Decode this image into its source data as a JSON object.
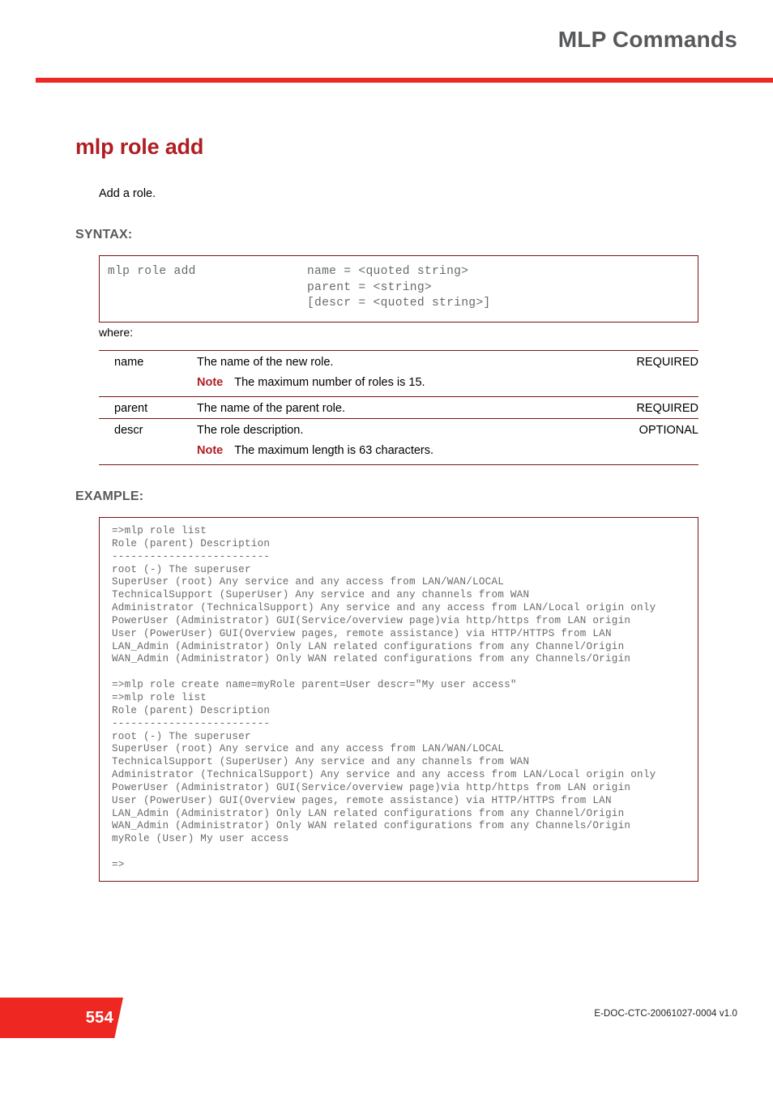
{
  "header": {
    "title": "MLP Commands",
    "rule_color": "#ee2722"
  },
  "page": {
    "section_title": "mlp role add",
    "intro": "Add a role.",
    "accent_color": "#b01e23",
    "box_border_color": "#7c1416"
  },
  "syntax": {
    "label": "SYNTAX:",
    "rows": [
      {
        "command": "mlp role add",
        "argument": "name = <quoted string>"
      },
      {
        "command": "",
        "argument": "parent = <string>"
      },
      {
        "command": "",
        "argument": "[descr = <quoted string>]"
      }
    ]
  },
  "where": {
    "label": "where:",
    "rows": [
      {
        "term": "name",
        "description": "The name of the new role.",
        "requirement": "REQUIRED",
        "note_keyword": "Note",
        "note": "The maximum number of roles is 15."
      },
      {
        "term": "parent",
        "description": "The name of the parent role.",
        "requirement": "REQUIRED",
        "note_keyword": "",
        "note": ""
      },
      {
        "term": "descr",
        "description": "The role description.",
        "requirement": "OPTIONAL",
        "note_keyword": "Note",
        "note": "The maximum length is 63 characters."
      }
    ]
  },
  "example": {
    "label": "EXAMPLE:",
    "code": "=>mlp role list\nRole (parent) Description\n-------------------------\nroot (-) The superuser\nSuperUser (root) Any service and any access from LAN/WAN/LOCAL\nTechnicalSupport (SuperUser) Any service and any channels from WAN\nAdministrator (TechnicalSupport) Any service and any access from LAN/Local origin only\nPowerUser (Administrator) GUI(Service/overview page)via http/https from LAN origin\nUser (PowerUser) GUI(Overview pages, remote assistance) via HTTP/HTTPS from LAN\nLAN_Admin (Administrator) Only LAN related configurations from any Channel/Origin\nWAN_Admin (Administrator) Only WAN related configurations from any Channels/Origin\n\n=>mlp role create name=myRole parent=User descr=\"My user access\"\n=>mlp role list\nRole (parent) Description\n-------------------------\nroot (-) The superuser\nSuperUser (root) Any service and any access from LAN/WAN/LOCAL\nTechnicalSupport (SuperUser) Any service and any channels from WAN\nAdministrator (TechnicalSupport) Any service and any access from LAN/Local origin only\nPowerUser (Administrator) GUI(Service/overview page)via http/https from LAN origin\nUser (PowerUser) GUI(Overview pages, remote assistance) via HTTP/HTTPS from LAN\nLAN_Admin (Administrator) Only LAN related configurations from any Channel/Origin\nWAN_Admin (Administrator) Only WAN related configurations from any Channels/Origin\nmyRole (User) My user access\n\n=>"
  },
  "footer": {
    "page_number": "554",
    "doc_ref": "E-DOC-CTC-20061027-0004 v1.0",
    "tab_color": "#ee2722"
  }
}
